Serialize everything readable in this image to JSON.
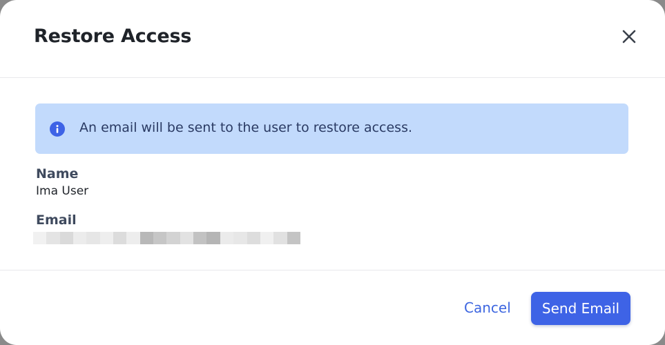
{
  "dialog": {
    "title": "Restore Access",
    "close_icon": "close-icon"
  },
  "banner": {
    "icon": "info-icon",
    "text": "An email will be sent to the user to restore access.",
    "background_color": "#c2dafc",
    "icon_color": "#3e63e6"
  },
  "fields": {
    "name_label": "Name",
    "name_value": "Ima User",
    "email_label": "Email"
  },
  "actions": {
    "cancel_label": "Cancel",
    "send_label": "Send Email",
    "primary_color": "#3e63e6"
  }
}
